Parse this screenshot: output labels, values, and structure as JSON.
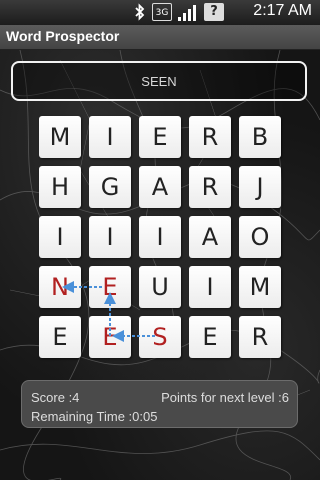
{
  "status_bar": {
    "time": "2:17 AM",
    "icons": [
      "bluetooth-icon",
      "3g-icon",
      "signal-icon",
      "battery-alert-icon"
    ],
    "network_label": "3G",
    "battery_label": "?"
  },
  "app": {
    "title": "Word Prospector"
  },
  "found_box": {
    "text": "SEEN"
  },
  "grid": {
    "rows": [
      [
        "M",
        "I",
        "E",
        "R",
        "B"
      ],
      [
        "H",
        "G",
        "A",
        "R",
        "J"
      ],
      [
        "I",
        "I",
        "I",
        "A",
        "O"
      ],
      [
        "N",
        "E",
        "U",
        "I",
        "M"
      ],
      [
        "E",
        "E",
        "S",
        "E",
        "R"
      ]
    ],
    "highlight_color": "#b12020",
    "path_color": "#4a90d9"
  },
  "stats": {
    "score": "Score :4",
    "points_next": "Points for next level :6",
    "remaining_time": "Remaining Time :0:05"
  }
}
